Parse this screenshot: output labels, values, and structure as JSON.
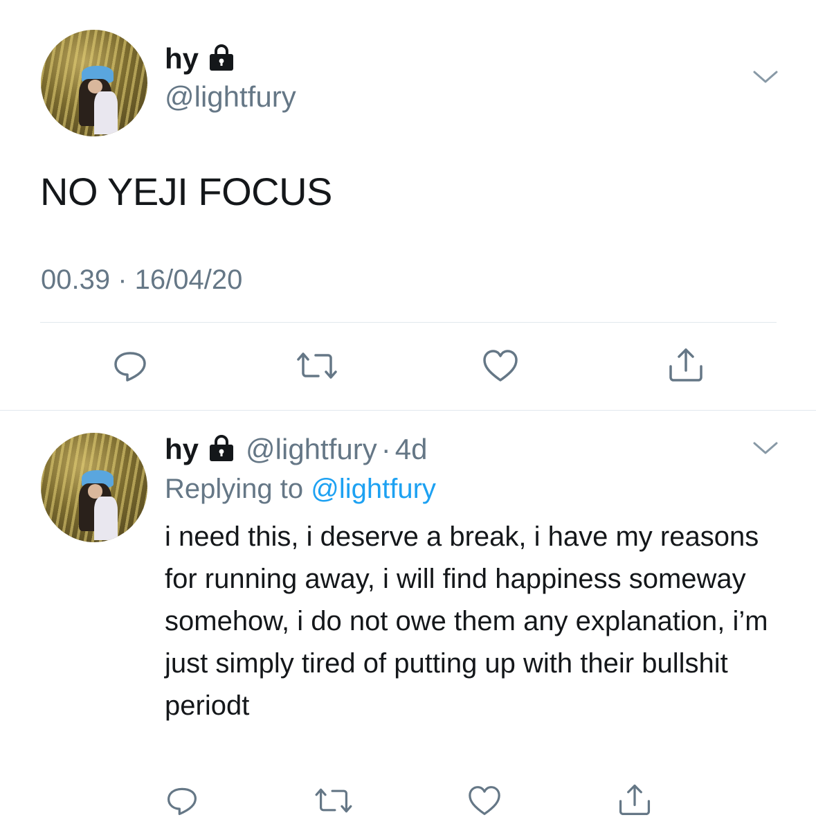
{
  "tweet": {
    "display_name": "hy",
    "handle": "@lightfury",
    "text": "NO YEJI FOCUS",
    "timestamp": "00.39 · 16/04/20",
    "menu_icon": "chevron-down-icon",
    "actions": [
      "reply-icon",
      "retweet-icon",
      "like-icon",
      "share-icon"
    ]
  },
  "reply": {
    "display_name": "hy",
    "handle": "@lightfury",
    "separator": "·",
    "age": "4d",
    "replying_to_label": "Replying to",
    "replying_to_handle": "@lightfury",
    "text": "i need this, i deserve a break, i have my reasons for running away, i will find happiness someway somehow, i do not owe them any explanation, i’m just simply tired of putting up with their bullshit periodt",
    "menu_icon": "chevron-down-icon",
    "actions": [
      "reply-icon",
      "retweet-icon",
      "like-icon",
      "share-icon"
    ]
  },
  "colors": {
    "text": "#14171a",
    "secondary": "#657786",
    "link": "#1da1f2",
    "divider": "#e1e8ed",
    "icon": "#657786"
  }
}
